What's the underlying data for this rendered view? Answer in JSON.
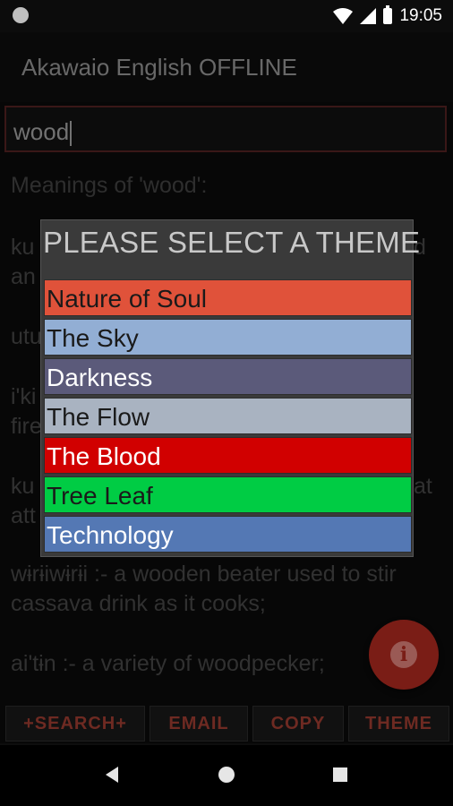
{
  "status_bar": {
    "time": "19:05"
  },
  "app": {
    "title": "Akawaio English OFFLINE"
  },
  "search": {
    "value": "wood"
  },
  "content": {
    "meanings_heading": "Meanings of 'wood':",
    "entries": [
      "ku",
      "an",
      "utu",
      "i'ki",
      "fire",
      "ku",
      "att",
      "wɨrɨiwɨrɨi :- a wooden beater used to stir cassava drink as it cooks;",
      "ai'tɨn :- a variety of woodpecker;"
    ],
    "right_fragments": [
      "d",
      "at"
    ]
  },
  "dialog": {
    "title": "PLEASE SELECT A THEME",
    "themes": [
      {
        "label": "Nature of Soul",
        "bg": "#e0523a",
        "fg": "#1a1a1a"
      },
      {
        "label": "The Sky",
        "bg": "#92aed4",
        "fg": "#1a1a1a"
      },
      {
        "label": "Darkness",
        "bg": "#5b5a7a",
        "fg": "#ffffff"
      },
      {
        "label": "The Flow",
        "bg": "#a9b3c1",
        "fg": "#1a1a1a"
      },
      {
        "label": "The Blood",
        "bg": "#d10000",
        "fg": "#ffffff"
      },
      {
        "label": "Tree Leaf",
        "bg": "#00cc44",
        "fg": "#1a1a1a"
      },
      {
        "label": "Technology",
        "bg": "#5478b4",
        "fg": "#ffffff"
      }
    ]
  },
  "bottom_buttons": {
    "search": "+SEARCH+",
    "email": "EMAIL",
    "copy": "COPY",
    "theme": "THEME"
  },
  "icons": {
    "fab": "info-icon",
    "nav_back": "back-icon",
    "nav_home": "home-icon",
    "nav_recent": "recent-apps-icon"
  }
}
